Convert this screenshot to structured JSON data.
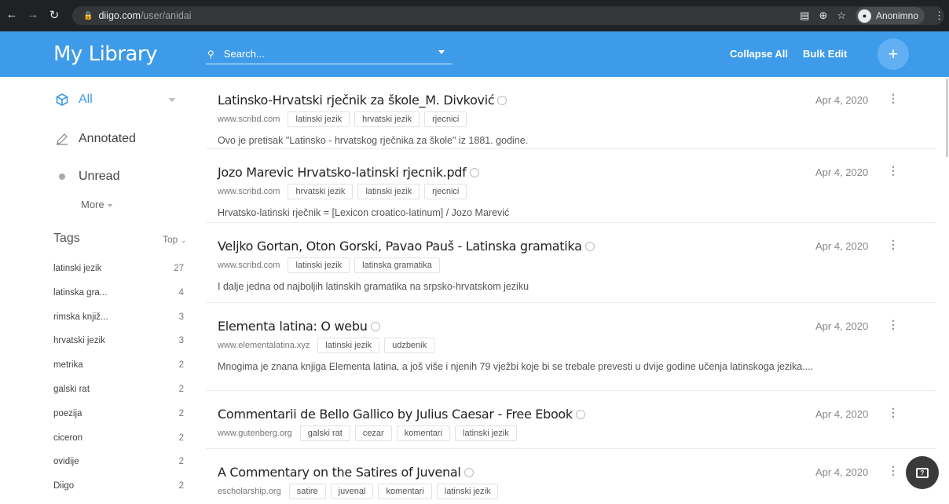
{
  "browser": {
    "url_host": "diigo.com",
    "url_path": "/user/anidai",
    "profile_name": "Anonimno"
  },
  "header": {
    "title": "My Library",
    "search_placeholder": "Search...",
    "collapse_all": "Collapse All",
    "bulk_edit": "Bulk Edit",
    "add": "+"
  },
  "sidebar": {
    "all": "All",
    "annotated": "Annotated",
    "unread": "Unread",
    "more": "More",
    "tags_title": "Tags",
    "tags_sort": "Top",
    "tags": [
      {
        "name": "latinski jezik",
        "count": "27"
      },
      {
        "name": "latinska gra...",
        "count": "4"
      },
      {
        "name": "rimska knjiž...",
        "count": "3"
      },
      {
        "name": "hrvatski jezik",
        "count": "3"
      },
      {
        "name": "metrika",
        "count": "2"
      },
      {
        "name": "galski rat",
        "count": "2"
      },
      {
        "name": "poezija",
        "count": "2"
      },
      {
        "name": "ciceron",
        "count": "2"
      },
      {
        "name": "ovidije",
        "count": "2"
      },
      {
        "name": "Diigo",
        "count": "2"
      }
    ]
  },
  "bookmarks": [
    {
      "title": "Latinsko-Hrvatski rječnik za škole_M. Divković",
      "date": "Apr 4, 2020",
      "url": "www.scribd.com",
      "tags": [
        "latinski jezik",
        "hrvatski jezik",
        "rjecnici"
      ],
      "desc": "Ovo je pretisak \"Latinsko - hrvatskog rječnika za škole\" iz 1881. godine."
    },
    {
      "title": "Jozo Marevic Hrvatsko-latinski rjecnik.pdf",
      "date": "Apr 4, 2020",
      "url": "www.scribd.com",
      "tags": [
        "hrvatski jezik",
        "latinski jezik",
        "rjecnici"
      ],
      "desc": "Hrvatsko-latinski rječnik = [Lexicon croatico-latinum] / Jozo Marević"
    },
    {
      "title": "Veljko Gortan, Oton Gorski, Pavao Pauš - Latinska gramatika",
      "date": "Apr 4, 2020",
      "url": "www.scribd.com",
      "tags": [
        "latinski jezik",
        "latinska gramatika"
      ],
      "desc": "I dalje jedna od najboljih latinskih gramatika na srpsko-hrvatskom jeziku"
    },
    {
      "title": "Elementa latina: O webu",
      "date": "Apr 4, 2020",
      "url": "www.elementalatina.xyz",
      "tags": [
        "latinski jezik",
        "udzbenik"
      ],
      "desc": "Mnogima je znana knjiga Elementa latina, a još više i njenih 79 vježbi koje bi se trebale prevesti u dvije godine učenja latinskoga jezika...."
    },
    {
      "title": "Commentarii de Bello Gallico by Julius Caesar - Free Ebook",
      "date": "Apr 4, 2020",
      "url": "www.gutenberg.org",
      "tags": [
        "galski rat",
        "cezar",
        "komentari",
        "latinski jezik"
      ],
      "desc": ""
    },
    {
      "title": "A Commentary on the Satires of Juvenal",
      "date": "Apr 4, 2020",
      "url": "escholarship.org",
      "tags": [
        "satire",
        "juvenal",
        "komentari",
        "latinski jezik"
      ],
      "desc": ""
    }
  ],
  "colors": {
    "accent": "#3d9be9",
    "chrome": "#202124"
  }
}
